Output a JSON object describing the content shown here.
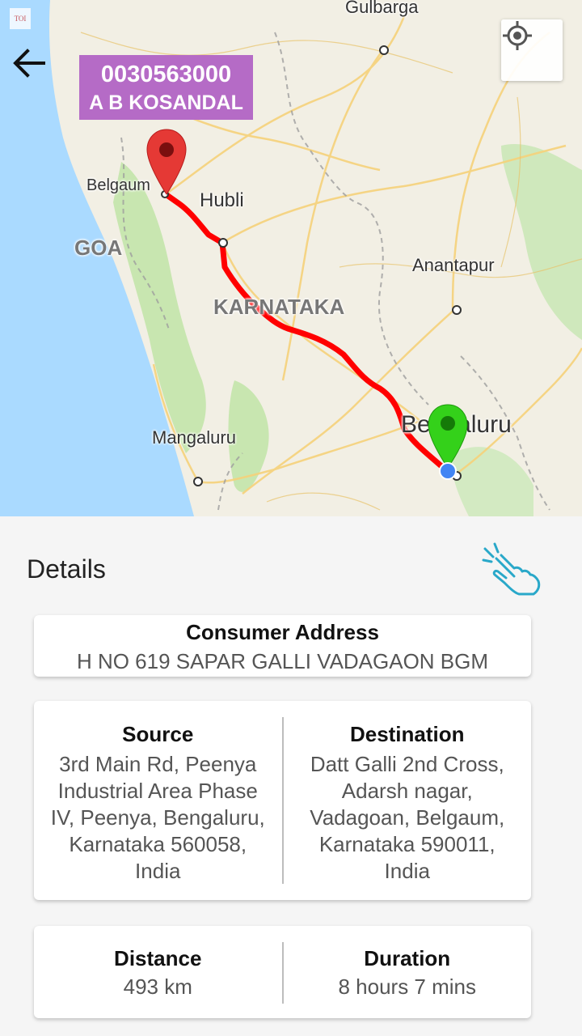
{
  "app": {
    "consumer_number": "0030563000",
    "consumer_name": "A B KOSANDAL",
    "toi_badge": "TOI"
  },
  "map": {
    "labels": {
      "gulbarga": "Gulbarga",
      "belgaum": "Belgaum",
      "hubli": "Hubli",
      "goa": "GOA",
      "anantapur": "Anantapur",
      "karnataka": "KARNATAKA",
      "bengaluru": "Bengaluru",
      "mangaluru": "Mangaluru"
    },
    "route_color": "#ff0000",
    "source_marker_color": "#34d11a",
    "destination_marker_color": "#e53935",
    "current_location_color": "#4285f4"
  },
  "details": {
    "title": "Details",
    "consumer_address": {
      "heading": "Consumer Address",
      "value": "H NO 619 SAPAR GALLI VADAGAON BGM"
    },
    "source": {
      "heading": "Source",
      "lines": [
        "3rd Main Rd, Peenya",
        "Industrial Area Phase",
        "IV, Peenya, Bengaluru,",
        "Karnataka 560058,",
        "India"
      ]
    },
    "destination": {
      "heading": "Destination",
      "lines": [
        "Datt Galli 2nd Cross,",
        "Adarsh nagar,",
        "Vadagoan, Belgaum,",
        "Karnataka 590011,",
        "India"
      ]
    },
    "distance": {
      "heading": "Distance",
      "value": "493 km"
    },
    "duration": {
      "heading": "Duration",
      "value": "8 hours 7 mins"
    }
  },
  "icons": {
    "back": "arrow-left-icon",
    "locate": "my-location-icon",
    "tap": "hand-tap-icon"
  }
}
